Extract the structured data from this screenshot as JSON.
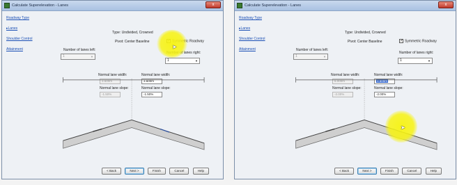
{
  "dialog": {
    "title": "Calculate Superelevation - Lanes",
    "close_glyph": "x"
  },
  "nav": {
    "roadway_type": "Roadway Type",
    "lanes": "Lanes",
    "shoulder_control": "Shoulder Control",
    "attainment": "Attainment",
    "current_marker": "▸"
  },
  "form": {
    "type_text": "Type: Undivided, Crowned",
    "pivot_text": "Pivot: Center Baseline",
    "symmetric_label": "Symmetric Roadway",
    "symmetric_checked": true,
    "lanes_left_label": "Number of lanes left:",
    "lanes_right_label": "Number of lanes right:",
    "lanes_left_value": "1",
    "lanes_right_value": "1",
    "left_width_label": "Normal lane width:",
    "right_width_label": "Normal lane width:",
    "left_slope_label": "Normal lane slope:",
    "right_slope_label": "Normal lane slope:"
  },
  "panels": {
    "left": {
      "left_width": "3.600m",
      "right_width": "3.600m",
      "left_slope": "-1.50%",
      "right_slope": "-1.50%"
    },
    "right": {
      "left_width": "6.000m",
      "right_width": "3.600m",
      "left_slope": "-2.00%",
      "right_slope": "-2.00%"
    }
  },
  "buttons": {
    "back": "< Back",
    "next": "Next >",
    "finish": "Finish",
    "cancel": "Cancel",
    "help": "Help"
  },
  "colors": {
    "highlight": "#f7f312",
    "link": "#1a4fb5",
    "road_surface": "#cfcfcf",
    "road_edge": "#6b6b6b"
  }
}
